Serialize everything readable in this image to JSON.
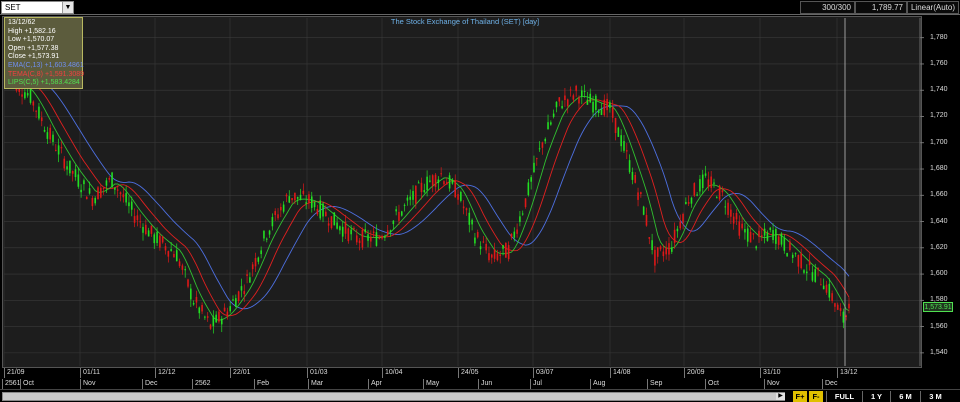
{
  "toolbar": {
    "symbol": "SET",
    "count": "300/300",
    "last": "1,789.77",
    "scale": "Linear(Auto)"
  },
  "chart_title": "The Stock Exchange of Thailand (SET) [day]",
  "info": {
    "date": "13/12/62",
    "high": "High  +1,582.16",
    "low": "Low  +1,570.07",
    "open": "Open  +1,577.38",
    "close": "Close  +1,573.91",
    "ema": "EMA(C,13)  +1,603.4861",
    "tema": "TEMA(C,8)  +1,591.3089",
    "lips": "LIPS(C,5)  +1,583.4284"
  },
  "last_price_badge": "1,573.91",
  "colors": {
    "background": "#1d1d1d",
    "grid": "#3a3a3a",
    "up": "#22e022",
    "down": "#e01818",
    "ema": "#4d6fe0",
    "tema": "#e02020",
    "lips": "#30c030",
    "title": "#6fb2e8",
    "badge": "#50e050"
  },
  "footer": {
    "fplus": "F+",
    "fminus": "F-",
    "full": "FULL",
    "y1": "1 Y",
    "m6": "6 M",
    "m3": "3 M"
  },
  "chart_data": {
    "type": "candlestick",
    "title": "The Stock Exchange of Thailand (SET) [day]",
    "ylim": [
      1530,
      1795
    ],
    "y_ticks": [
      "1,540",
      "1,560",
      "1,580",
      "1,600",
      "1,620",
      "1,640",
      "1,660",
      "1,680",
      "1,700",
      "1,720",
      "1,740",
      "1,760",
      "1,780"
    ],
    "y_tick_values": [
      1540,
      1560,
      1580,
      1600,
      1620,
      1640,
      1660,
      1680,
      1700,
      1720,
      1740,
      1760,
      1780
    ],
    "x_date_labels": [
      "21/09",
      "01/11",
      "12/12",
      "22/01",
      "01/03",
      "10/04",
      "24/05",
      "03/07",
      "14/08",
      "20/09",
      "31/10",
      "13/12"
    ],
    "x_month_labels": [
      "2561",
      "Oct",
      "Nov",
      "Dec",
      "2562",
      "Feb",
      "Mar",
      "Apr",
      "May",
      "Jun",
      "Jul",
      "Aug",
      "Sep",
      "Oct",
      "Nov",
      "Dec"
    ],
    "n_bars": 300,
    "close_path": [
      [
        0,
        1752
      ],
      [
        8,
        1735
      ],
      [
        15,
        1705
      ],
      [
        22,
        1680
      ],
      [
        30,
        1658
      ],
      [
        37,
        1672
      ],
      [
        45,
        1645
      ],
      [
        52,
        1628
      ],
      [
        60,
        1615
      ],
      [
        66,
        1580
      ],
      [
        72,
        1560
      ],
      [
        78,
        1572
      ],
      [
        85,
        1595
      ],
      [
        92,
        1632
      ],
      [
        100,
        1660
      ],
      [
        108,
        1655
      ],
      [
        116,
        1640
      ],
      [
        124,
        1627
      ],
      [
        132,
        1628
      ],
      [
        140,
        1648
      ],
      [
        148,
        1668
      ],
      [
        154,
        1676
      ],
      [
        160,
        1662
      ],
      [
        166,
        1630
      ],
      [
        172,
        1612
      ],
      [
        178,
        1618
      ],
      [
        184,
        1656
      ],
      [
        190,
        1700
      ],
      [
        196,
        1730
      ],
      [
        202,
        1738
      ],
      [
        208,
        1730
      ],
      [
        214,
        1726
      ],
      [
        220,
        1690
      ],
      [
        226,
        1650
      ],
      [
        230,
        1612
      ],
      [
        236,
        1622
      ],
      [
        242,
        1658
      ],
      [
        248,
        1672
      ],
      [
        254,
        1660
      ],
      [
        260,
        1636
      ],
      [
        266,
        1625
      ],
      [
        272,
        1632
      ],
      [
        278,
        1618
      ],
      [
        284,
        1605
      ],
      [
        290,
        1595
      ],
      [
        294,
        1578
      ],
      [
        297,
        1565
      ],
      [
        299,
        1574
      ]
    ],
    "series": [
      {
        "name": "EMA(C,13)",
        "value_last": 1603.4861
      },
      {
        "name": "TEMA(C,8)",
        "value_last": 1591.3089
      },
      {
        "name": "LIPS(C,5)",
        "value_last": 1583.4284
      }
    ],
    "last_candle": {
      "date": "13/12/62",
      "high": 1582.16,
      "low": 1570.07,
      "open": 1577.38,
      "close": 1573.91
    }
  }
}
